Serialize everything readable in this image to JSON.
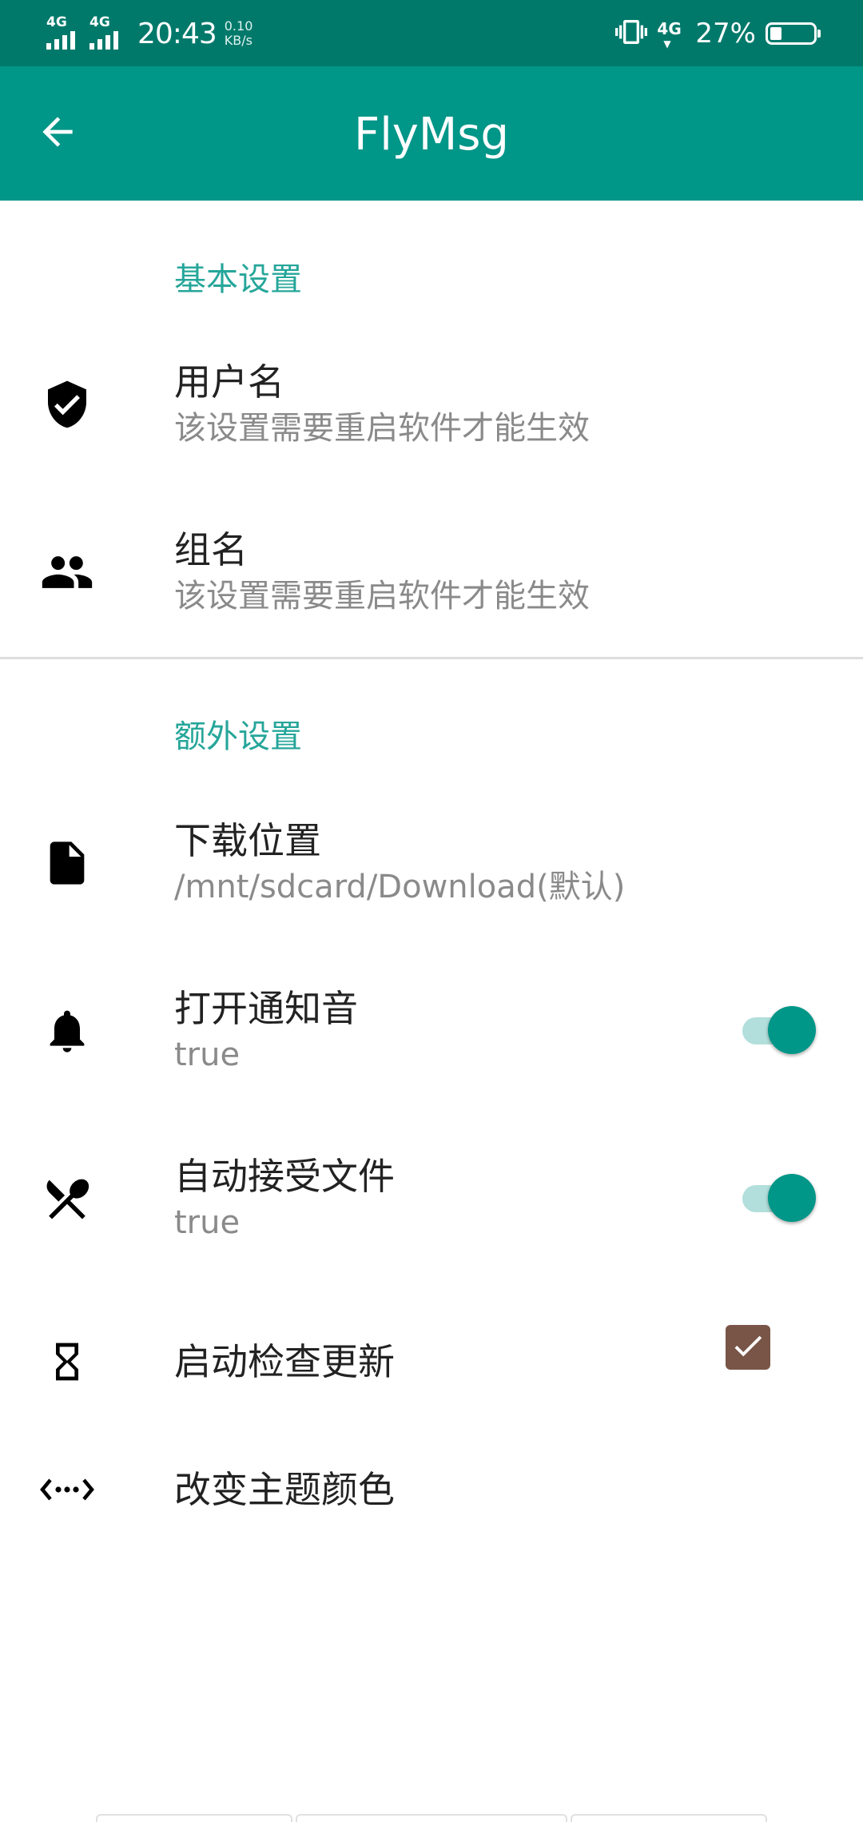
{
  "status_bar": {
    "signal_1_label": "4G",
    "signal_2_label": "4G",
    "time": "20:43",
    "net_speed_value": "0.10",
    "net_speed_unit": "KB/s",
    "network_label": "4G",
    "battery_percent": "27%",
    "battery_level": 0.27
  },
  "app_bar": {
    "title": "FlyMsg",
    "back_icon": "arrow-left-icon",
    "background_color": "#009688"
  },
  "colors": {
    "status_bar": "#00796b",
    "accent": "#009688",
    "section_header": "#26a69a",
    "checkbox": "#795548",
    "switch_track": "#b2dfdb"
  },
  "sections": {
    "basic": {
      "header": "基本设置",
      "items": {
        "username": {
          "icon": "verified-shield-icon",
          "title": "用户名",
          "summary": "该设置需要重启软件才能生效"
        },
        "group": {
          "icon": "group-icon",
          "title": "组名",
          "summary": "该设置需要重启软件才能生效"
        }
      }
    },
    "extra": {
      "header": "额外设置",
      "items": {
        "download": {
          "icon": "file-icon",
          "title": "下载位置",
          "summary": "/mnt/sdcard/Download(默认)"
        },
        "notify_sound": {
          "icon": "bell-icon",
          "title": "打开通知音",
          "summary": "true",
          "switch_on": true
        },
        "auto_accept": {
          "icon": "utensils-icon",
          "title": "自动接受文件",
          "summary": "true",
          "switch_on": true
        },
        "check_update": {
          "icon": "hourglass-icon",
          "title": "启动检查更新",
          "checked": true
        },
        "theme": {
          "icon": "code-arrows-icon",
          "title": "改变主题颜色"
        }
      }
    }
  }
}
